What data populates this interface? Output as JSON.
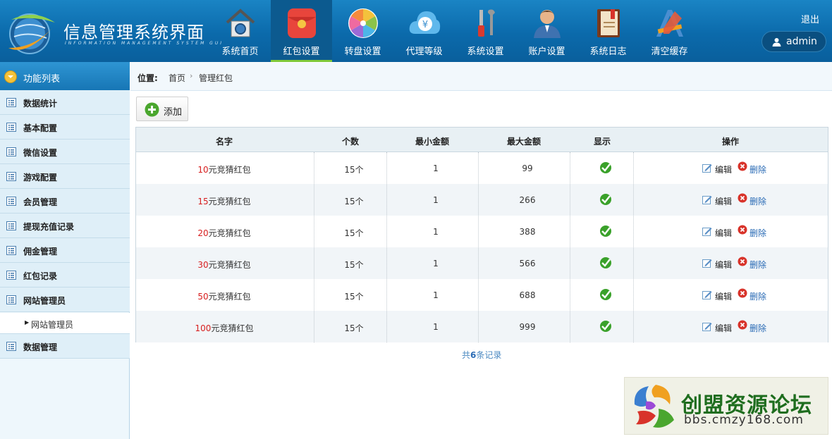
{
  "header": {
    "logo_title": "信息管理系统界面",
    "logo_subtitle": "INFORMATION MANAGEMENT SYSTEM GUI",
    "nav": [
      {
        "label": "系统首页",
        "icon": "house-icon"
      },
      {
        "label": "红包设置",
        "icon": "red-envelope-icon",
        "active": true
      },
      {
        "label": "转盘设置",
        "icon": "color-wheel-icon"
      },
      {
        "label": "代理等级",
        "icon": "yen-cloud-icon"
      },
      {
        "label": "系统设置",
        "icon": "tools-icon"
      },
      {
        "label": "账户设置",
        "icon": "user-account-icon"
      },
      {
        "label": "系统日志",
        "icon": "log-book-icon"
      },
      {
        "label": "清空缓存",
        "icon": "clear-cache-icon"
      }
    ],
    "logout": "退出",
    "username": "admin"
  },
  "sidebar": {
    "title": "功能列表",
    "items": [
      {
        "label": "数据统计"
      },
      {
        "label": "基本配置"
      },
      {
        "label": "微信设置"
      },
      {
        "label": "游戏配置"
      },
      {
        "label": "会员管理"
      },
      {
        "label": "提现充值记录"
      },
      {
        "label": "佣金管理"
      },
      {
        "label": "红包记录"
      },
      {
        "label": "网站管理员"
      },
      {
        "label": "数据管理"
      }
    ],
    "sub_item": "网站管理员"
  },
  "breadcrumb": {
    "position_label": "位置:",
    "home": "首页",
    "separator": "›",
    "current": "管理红包"
  },
  "toolbar": {
    "add_label": "添加"
  },
  "table": {
    "headers": [
      "名字",
      "个数",
      "最小金额",
      "最大金额",
      "显示",
      "操作"
    ],
    "rows": [
      {
        "amount": "10",
        "suffix": "元竞猜红包",
        "count": "15个",
        "min": "1",
        "max": "99"
      },
      {
        "amount": "15",
        "suffix": "元竞猜红包",
        "count": "15个",
        "min": "1",
        "max": "266"
      },
      {
        "amount": "20",
        "suffix": "元竞猜红包",
        "count": "15个",
        "min": "1",
        "max": "388"
      },
      {
        "amount": "30",
        "suffix": "元竞猜红包",
        "count": "15个",
        "min": "1",
        "max": "566"
      },
      {
        "amount": "50",
        "suffix": "元竞猜红包",
        "count": "15个",
        "min": "1",
        "max": "688"
      },
      {
        "amount": "100",
        "suffix": "元竞猜红包",
        "count": "15个",
        "min": "1",
        "max": "999"
      }
    ],
    "edit_label": "编辑",
    "delete_label": "删除"
  },
  "footer": {
    "prefix": "共",
    "count": "6",
    "suffix": "条记录"
  },
  "watermark": {
    "title": "创盟资源论坛",
    "url": "bbs.cmzy168.com"
  },
  "colors": {
    "header_bg": "#0b6aab",
    "active_tab_underline": "#7fc93a",
    "name_amount": "#d71e1e",
    "link_blue": "#2a6bb5",
    "check_green": "#3aa12a"
  }
}
